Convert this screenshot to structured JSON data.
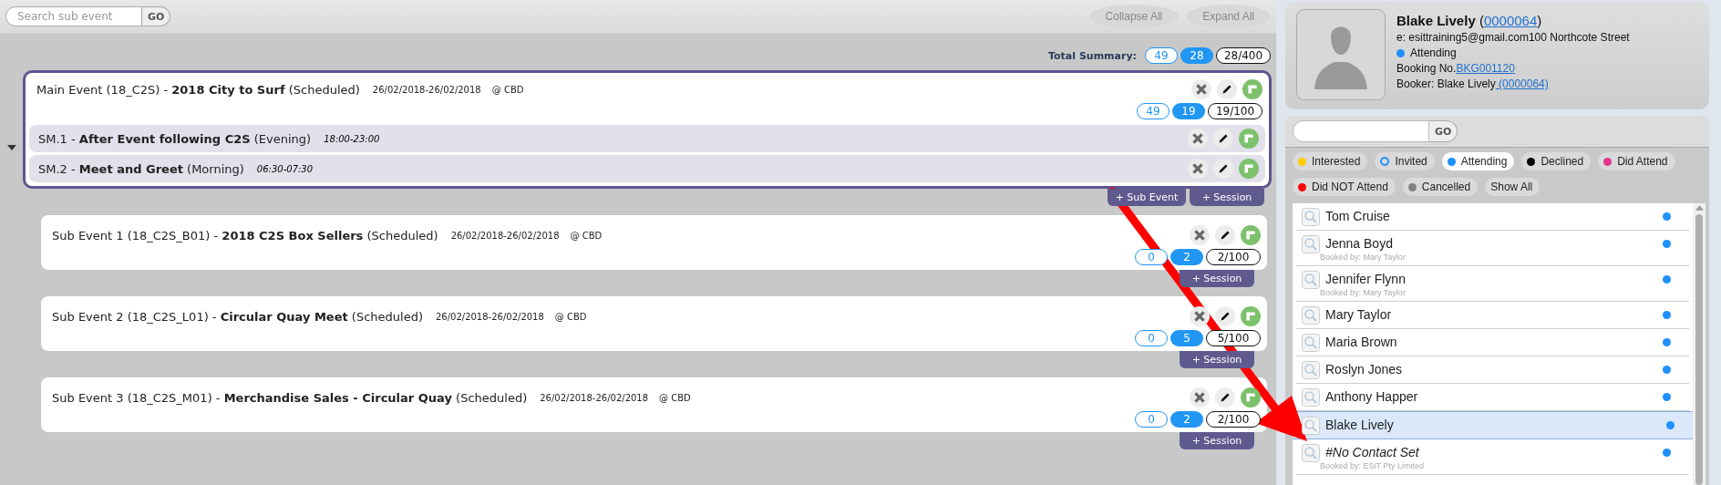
{
  "toolbar": {
    "search": {
      "placeholder": "Search sub event",
      "button": "GO"
    },
    "collapse_all": "Collapse All",
    "expand_all": "Expand All"
  },
  "total_summary": {
    "label": "Total Summary:",
    "counts": [
      "49",
      "28",
      "28/400"
    ]
  },
  "main_event": {
    "expanded": true,
    "title": "Main Event (18_C2S) - **2018 City to Surf** (Scheduled)",
    "dates": "26/02/2018-26/02/2018",
    "location": "@ CBD",
    "counts": [
      "49",
      "19",
      "19/100"
    ],
    "sessions": [
      {
        "code": "SM.1 - ",
        "name": "After Event following C2S",
        "period": " (Evening)",
        "time": "18:00-23:00"
      },
      {
        "code": "SM.2 - ",
        "name": "Meet and Greet",
        "period": " (Morning)",
        "time": "06:30-07:30"
      }
    ],
    "buttons": [
      "+ Sub Event",
      "+ Session"
    ]
  },
  "sub_events": [
    {
      "title": "Sub Event 1 (18_C2S_B01) - **2018 C2S Box Sellers** (Scheduled)",
      "dates": "26/02/2018-26/02/2018",
      "location": "@ CBD",
      "counts": [
        "0",
        "2",
        "2/100"
      ],
      "buttons": [
        "+ Session"
      ]
    },
    {
      "title": "Sub Event 2 (18_C2S_L01) - **Circular Quay Meet** (Scheduled)",
      "dates": "26/02/2018-26/02/2018",
      "location": "@ CBD",
      "counts": [
        "0",
        "5",
        "5/100"
      ],
      "buttons": [
        "+ Session"
      ]
    },
    {
      "title": "Sub Event 3 (18_C2S_M01) - **Merchandise Sales - Circular Quay** (Scheduled)",
      "dates": "26/02/2018-26/02/2018",
      "location": "@ CBD",
      "counts": [
        "0",
        "2",
        "2/100"
      ],
      "buttons": [
        "+ Session"
      ]
    }
  ],
  "profile": {
    "name": "Blake Lively",
    "id_open": "(",
    "id_link": "0000064",
    "id_close": ")",
    "email": "e: esittraining5@gmail.com100 Northcote Street",
    "status": "Attending",
    "booking_label": "Booking No.",
    "booking_link": "BKG001120",
    "booker_label": "Booker: Blake Lively",
    "booker_link": " (0000064)"
  },
  "attendee_search": {
    "button": "GO"
  },
  "filters": [
    {
      "label": "Interested",
      "kind": "dot",
      "color": "#ffcc00",
      "selected": false
    },
    {
      "label": "Invited",
      "kind": "ring",
      "color": "#1e90ff",
      "selected": false
    },
    {
      "label": "Attending",
      "kind": "dot",
      "color": "#1e90ff",
      "selected": true
    },
    {
      "label": "Declined",
      "kind": "dot",
      "color": "#000000",
      "selected": false
    },
    {
      "label": "Did Attend",
      "kind": "dot",
      "color": "#e0368c",
      "selected": false
    },
    {
      "label": "Did NOT Attend",
      "kind": "dot",
      "color": "#ff0000",
      "selected": false
    },
    {
      "label": "Cancelled",
      "kind": "dot",
      "color": "#808080",
      "selected": false
    },
    {
      "label": "Show All",
      "kind": "plain",
      "selected": false
    }
  ],
  "attendees": [
    {
      "name": "Tom Cruise",
      "kind": "contact",
      "color": "#1e90ff",
      "selected": false
    },
    {
      "name": "Jenna Boyd",
      "kind": "contact",
      "booked_by": "Booked by: Mary Taylor",
      "color": "#1e90ff",
      "selected": false
    },
    {
      "name": "Jennifer Flynn",
      "kind": "contact",
      "booked_by": "Booked by: Mary Taylor",
      "color": "#1e90ff",
      "selected": false
    },
    {
      "name": "Mary Taylor",
      "kind": "contact",
      "color": "#1e90ff",
      "selected": false
    },
    {
      "name": "Maria Brown",
      "kind": "contact",
      "color": "#1e90ff",
      "selected": false
    },
    {
      "name": "Roslyn Jones",
      "kind": "contact",
      "color": "#1e90ff",
      "selected": false
    },
    {
      "name": "Anthony Happer",
      "kind": "contact",
      "color": "#1e90ff",
      "selected": false
    },
    {
      "name": "Blake Lively",
      "kind": "contact",
      "color": "#1e90ff",
      "selected": true
    },
    {
      "name": "#No Contact Set",
      "kind": "no_contact",
      "booked_by": "Booked by:  ESiT Pty Limited",
      "color": "#1e90ff",
      "selected": false
    }
  ]
}
